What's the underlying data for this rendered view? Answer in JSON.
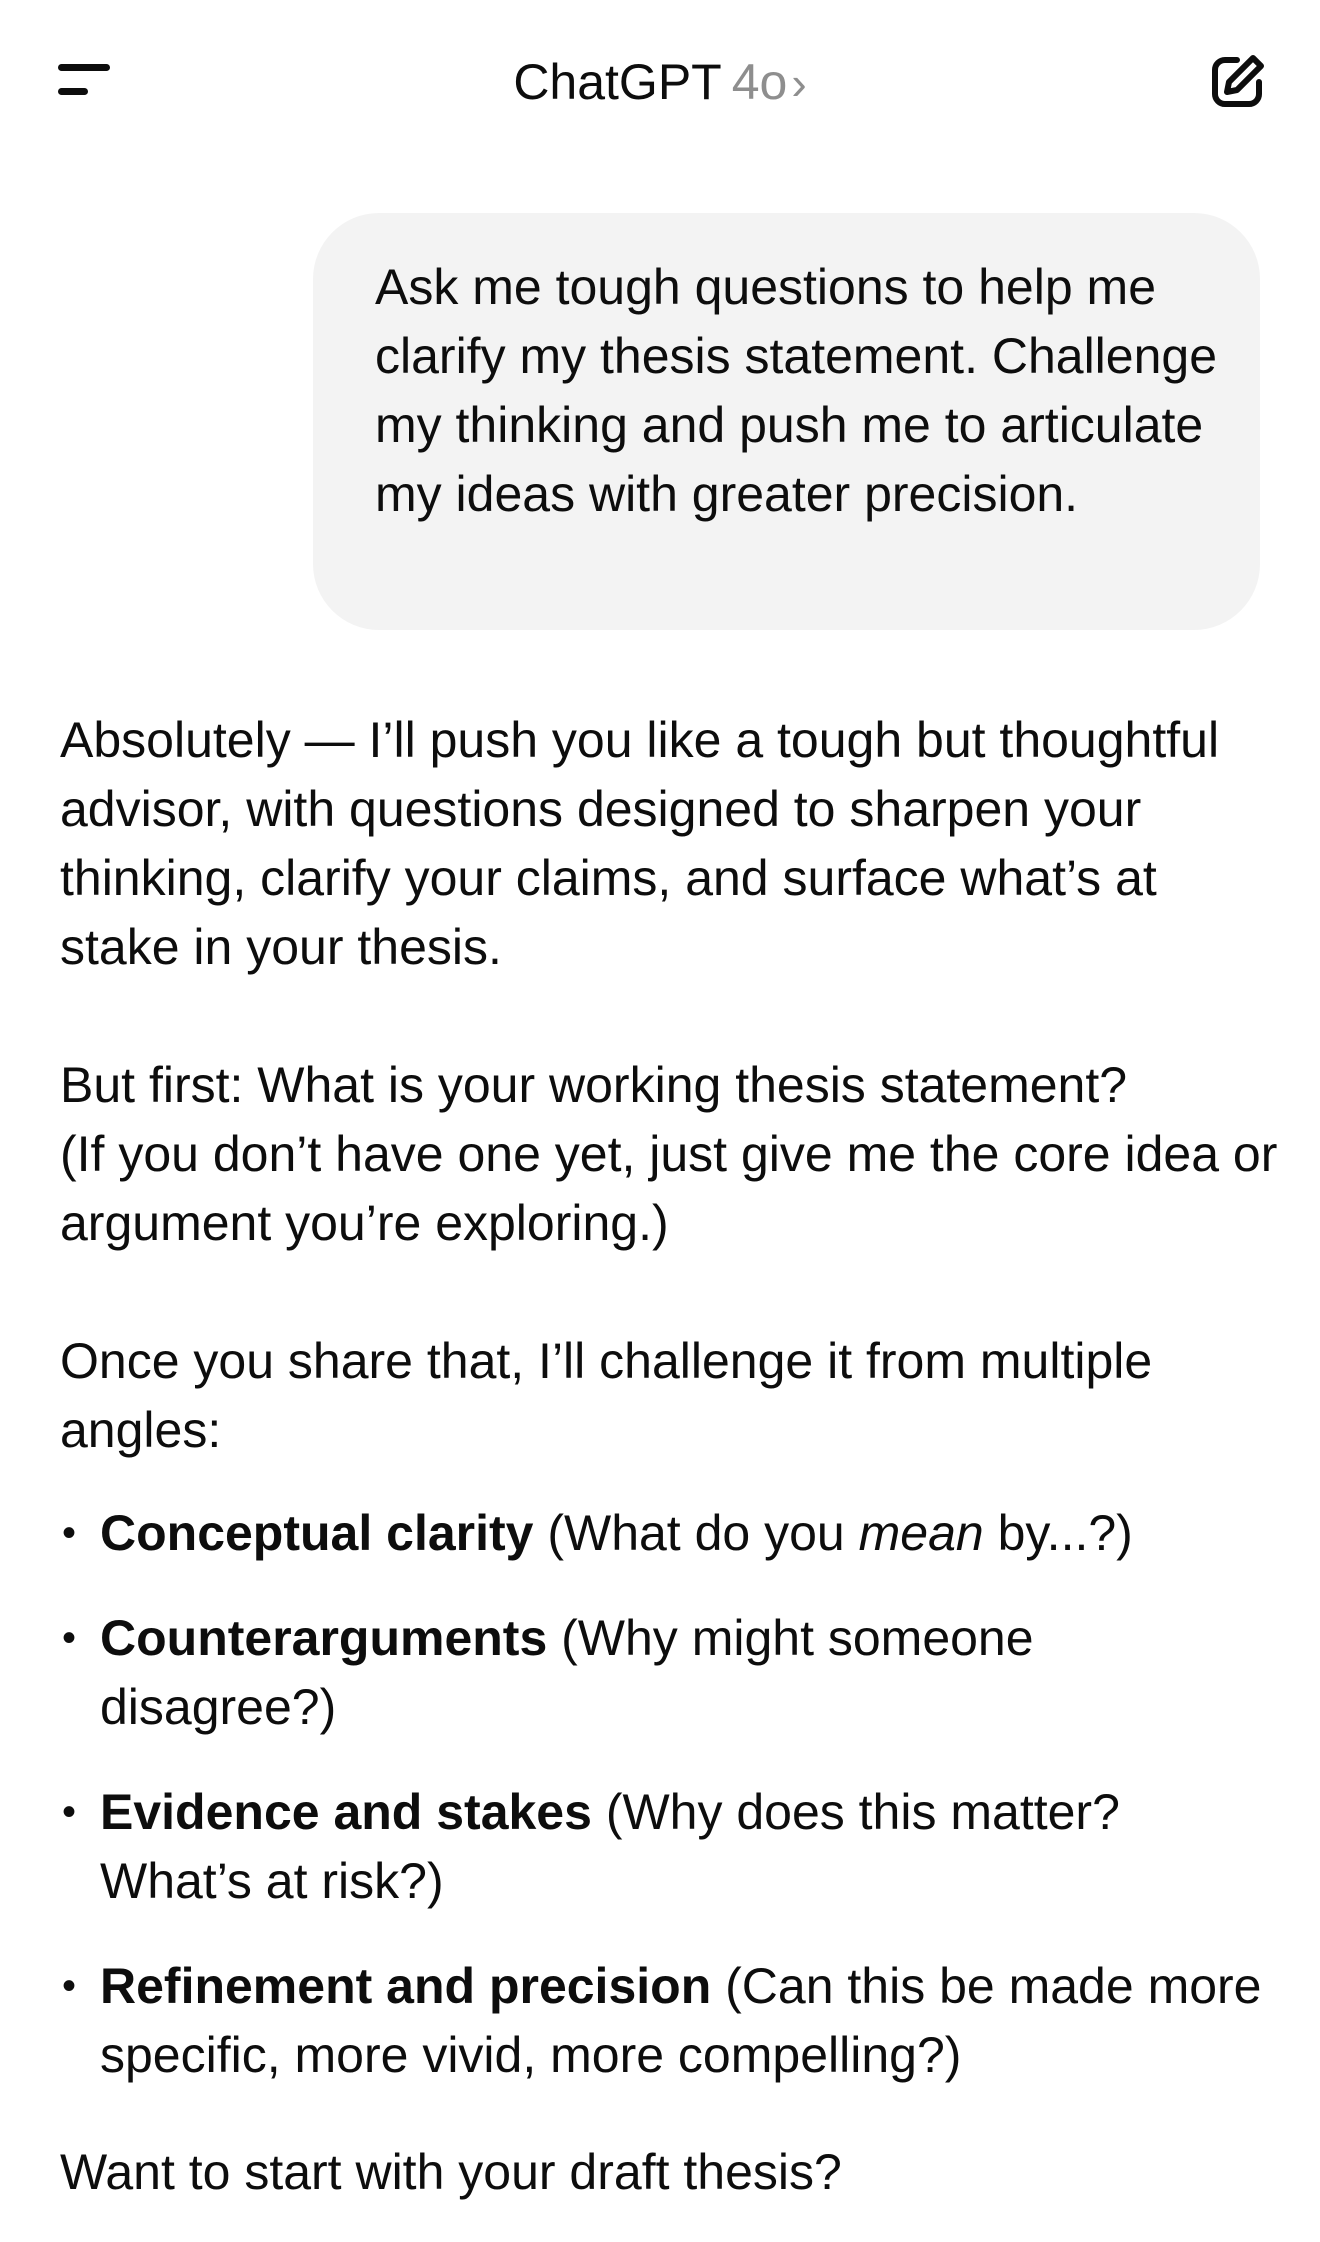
{
  "header": {
    "app_title": "ChatGPT",
    "model": "4o",
    "chevron": "›",
    "menu_icon": "hamburger-menu-icon",
    "compose_icon": "new-chat-pencil-icon"
  },
  "conversation": {
    "user_message": "Ask me tough questions to help me clarify my thesis statement. Challenge my thinking and push me to articulate my ideas with greater precision.",
    "assistant": {
      "para1": "Absolutely — I’ll push you like a tough but thoughtful advisor, with questions designed to sharpen your thinking, clarify your claims, and surface what’s at stake in your thesis.",
      "para2_line1": "But first: What is your working thesis statement?",
      "para2_line2": "(If you don’t have one yet, just give me the core idea or argument you’re exploring.)",
      "para3": "Once you share that, I’ll challenge it from multiple angles:",
      "bullets": [
        {
          "title": "Conceptual clarity",
          "text_before": " (What do you ",
          "emphasis": "mean",
          "text_after": " by...?)"
        },
        {
          "title": "Counterarguments",
          "text": " (Why might someone disagree?)"
        },
        {
          "title": "Evidence and stakes",
          "text": " (Why does this matter? What’s at risk?)"
        },
        {
          "title": "Refinement and precision",
          "text": " (Can this be made more specific, more vivid, more compelling?)"
        }
      ],
      "closing": "Want to start with your draft thesis?"
    }
  },
  "colors": {
    "text": "#0d0d0d",
    "muted": "#8e8e8e",
    "user_bubble": "#f3f3f3",
    "background": "#ffffff"
  }
}
